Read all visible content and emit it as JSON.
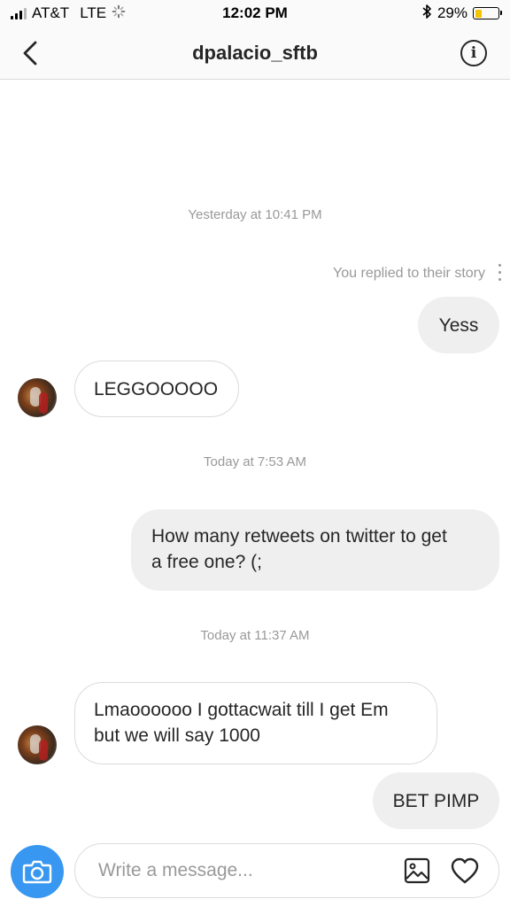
{
  "status_bar": {
    "carrier": "AT&T",
    "network": "LTE",
    "time": "12:02 PM",
    "battery_percent": "29%",
    "battery_level": 0.29
  },
  "header": {
    "title": "dpalacio_sftb"
  },
  "thread": {
    "timestamp_1": "Yesterday at 10:41 PM",
    "story_reply_note": "You replied to their story",
    "msg_1": "Yess",
    "msg_2": "LEGGOOOOO",
    "timestamp_2": "Today at 7:53 AM",
    "msg_3_line1": "How many retweets on twitter to get",
    "msg_3_line2": "a free one? (;",
    "timestamp_3": "Today at 11:37 AM",
    "msg_4_line1": "Lmaoooooo I gottacwait till I get Em",
    "msg_4_line2": "but we will say 1000",
    "msg_5": "BET PIMP"
  },
  "composer": {
    "placeholder": "Write a message..."
  },
  "colors": {
    "accent": "#3897f0",
    "outgoing_bubble": "#efefef",
    "incoming_border": "#dbdbdb",
    "muted_text": "#999999",
    "battery": "#f5c400"
  },
  "icons": [
    "signal-icon",
    "loading-icon",
    "bluetooth-icon",
    "battery-icon",
    "back-chevron-icon",
    "info-icon",
    "more-icon",
    "camera-icon",
    "gallery-icon",
    "heart-icon"
  ]
}
